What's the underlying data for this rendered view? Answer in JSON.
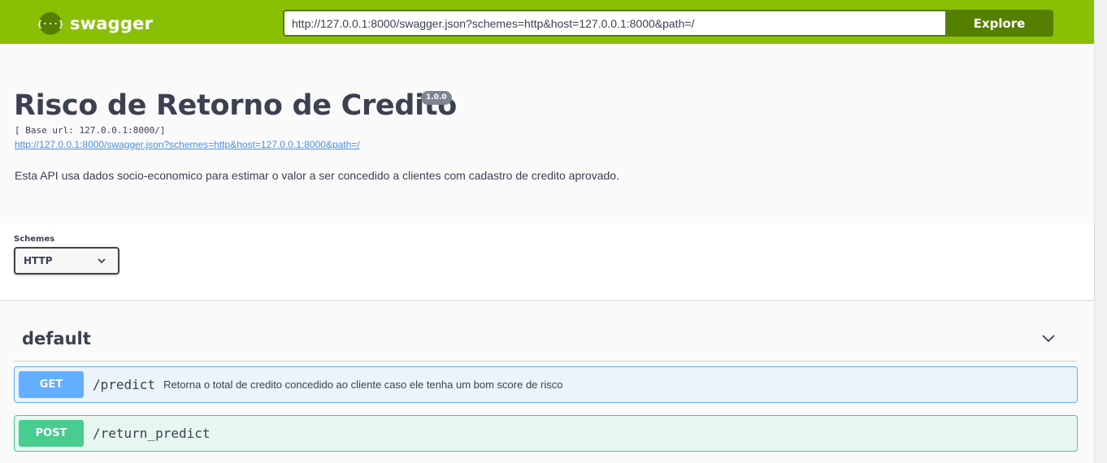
{
  "topbar": {
    "logo_icon_text": "{···}",
    "logo_text": "swagger",
    "url_value": "http://127.0.0.1:8000/swagger.json?schemes=http&host=127.0.0.1:8000&path=/",
    "explore_label": "Explore"
  },
  "info": {
    "title": "Risco de Retorno de Credito",
    "version": "1.0.0",
    "base_url": "[ Base url: 127.0.0.1:8000/]",
    "spec_link": "http://127.0.0.1:8000/swagger.json?schemes=http&host=127.0.0.1:8000&path=/",
    "description": "Esta API usa dados socio-economico para estimar o valor a ser concedido a clientes com cadastro de credito aprovado."
  },
  "schemes": {
    "label": "Schemes",
    "selected": "HTTP"
  },
  "tag": {
    "name": "default"
  },
  "operations": [
    {
      "method": "GET",
      "path": "/predict",
      "summary": "Retorna o total de credito concedido ao cliente caso ele tenha um bom score de risco"
    },
    {
      "method": "POST",
      "path": "/return_predict",
      "summary": ""
    }
  ],
  "colors": {
    "topbar": "#89bf04",
    "topbar_dark": "#547f00",
    "get": "#61affe",
    "post": "#49cc90",
    "link": "#4990e2"
  }
}
